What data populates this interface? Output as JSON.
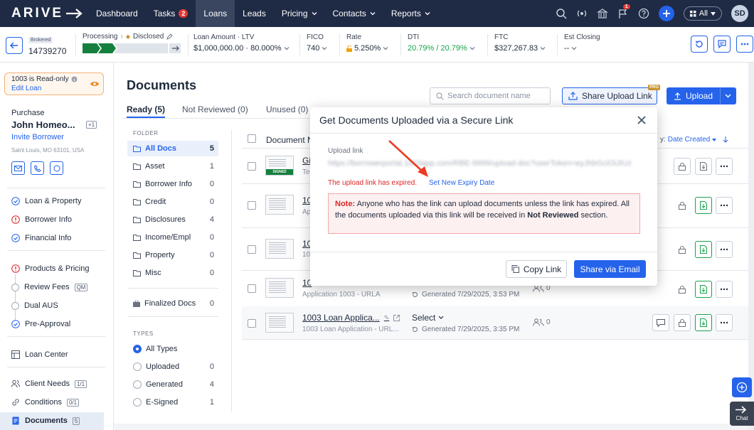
{
  "nav": {
    "logo": "ARIVE",
    "items": [
      {
        "label": "Dashboard"
      },
      {
        "label": "Tasks",
        "badge": "2"
      },
      {
        "label": "Loans"
      },
      {
        "label": "Leads"
      },
      {
        "label": "Pricing"
      },
      {
        "label": "Contacts"
      },
      {
        "label": "Reports"
      }
    ],
    "notification_badge": "1",
    "all_label": "All",
    "avatar": "SD"
  },
  "loan_bar": {
    "brokered": "Brokered",
    "loan_number": "14739270",
    "processing": "Processing",
    "disclosed": "Disclosed",
    "amount_label": "Loan Amount · LTV",
    "amount_value": "$1,000,000.00 · 80.000%",
    "fico_label": "FICO",
    "fico_value": "740",
    "rate_label": "Rate",
    "rate_value": "5.250%",
    "dti_label": "DTI",
    "dti_value": "20.79% / 20.79%",
    "ftc_label": "FTC",
    "ftc_value": "$327,267.83",
    "closing_label": "Est Closing",
    "closing_value": "--"
  },
  "sidebar": {
    "readonly_title": "1003 is Read-only",
    "edit_loan": "Edit Loan",
    "purpose": "Purchase",
    "borrower": "John Homeo...",
    "extra_count": "+1",
    "invite": "Invite Borrower",
    "location": "Saint Louis, MO 63101, USA",
    "items": [
      {
        "label": "Loan & Property"
      },
      {
        "label": "Borrower Info"
      },
      {
        "label": "Financial Info"
      },
      {
        "label": "Products & Pricing"
      },
      {
        "label": "Review Fees",
        "tag": "QM"
      },
      {
        "label": "Dual AUS"
      },
      {
        "label": "Pre-Approval"
      },
      {
        "label": "Loan Center"
      },
      {
        "label": "Client Needs",
        "tag": "1/1"
      },
      {
        "label": "Conditions",
        "tag": "0/1"
      },
      {
        "label": "Documents",
        "tag": "5"
      }
    ]
  },
  "documents": {
    "title": "Documents",
    "tabs": [
      "Ready (5)",
      "Not Reviewed (0)",
      "Unused (0)"
    ],
    "search_placeholder": "Search document name",
    "share_upload": "Share Upload Link",
    "pro": "PRO",
    "upload": "Upload",
    "folder_header": "FOLDER",
    "folders": [
      {
        "name": "All Docs",
        "count": "5"
      },
      {
        "name": "Asset",
        "count": "1"
      },
      {
        "name": "Borrower Info",
        "count": "0"
      },
      {
        "name": "Credit",
        "count": "0"
      },
      {
        "name": "Disclosures",
        "count": "4"
      },
      {
        "name": "Income/Empl",
        "count": "0"
      },
      {
        "name": "Property",
        "count": "0"
      },
      {
        "name": "Misc",
        "count": "0"
      },
      {
        "name": "Finalized Docs",
        "count": "0"
      }
    ],
    "types_header": "TYPES",
    "types": [
      {
        "name": "All Types",
        "count": ""
      },
      {
        "name": "Uploaded",
        "count": "0"
      },
      {
        "name": "Generated",
        "count": "4"
      },
      {
        "name": "E-Signed",
        "count": "1"
      }
    ],
    "column_doc": "Document N",
    "sort_prefix": "y:",
    "sort_value": "Date Created",
    "rows": [
      {
        "name": "Gi",
        "sub": "Te",
        "thumb_tag": "SIGNED"
      },
      {
        "name": "10",
        "sub": "Ap"
      },
      {
        "name": "10",
        "sub": "10"
      },
      {
        "name": "10",
        "sub": "Application 1003 - URLA",
        "generated": "Generated 7/29/2025, 3:53 PM",
        "users": "0"
      },
      {
        "name": "1003 Loan Applica...",
        "sub": "1003 Loan Application - URL...",
        "select": "Select",
        "generated": "Generated 7/29/2025, 3:35 PM",
        "users": "0"
      }
    ]
  },
  "modal": {
    "title": "Get Documents Uploaded via a Secure Link",
    "link_label": "Upload link",
    "link_value": "https://borrowerportal.1003app.com/RBE-9999/upload-doc?userToken=eyJhbGciOiJIUz",
    "expired": "The upload link has expired.",
    "set_new": "Set New Expiry Date",
    "note_label": "Note:",
    "note_text": "Anyone who has the link can upload documents unless the link has expired. All the documents uploaded via this link will be received in",
    "note_bold": "Not Reviewed",
    "note_end": "section.",
    "copy": "Copy Link",
    "email": "Share via Email"
  },
  "chat": "Chat"
}
